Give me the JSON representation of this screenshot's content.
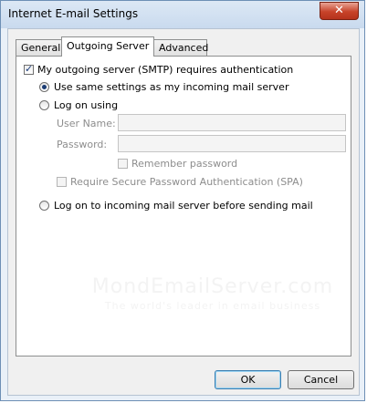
{
  "window": {
    "title": "Internet E-mail Settings",
    "close_glyph": "✕"
  },
  "tabs": [
    {
      "label": "General",
      "active": false
    },
    {
      "label": "Outgoing Server",
      "active": true
    },
    {
      "label": "Advanced",
      "active": false
    }
  ],
  "outgoing": {
    "requires_auth_label": "My outgoing server (SMTP) requires authentication",
    "requires_auth_checked": true,
    "use_same_label": "Use same settings as my incoming mail server",
    "log_on_using_label": "Log on using",
    "user_name_label": "User Name:",
    "user_name_value": "",
    "password_label": "Password:",
    "password_value": "",
    "remember_password_label": "Remember password",
    "spa_label": "Require Secure Password Authentication (SPA)",
    "log_on_incoming_label": "Log on to incoming mail server before sending mail",
    "selected_option": "use_same"
  },
  "watermark": {
    "line1": "MondEmailServer.com",
    "line2": "The world's leader in email business"
  },
  "buttons": {
    "ok_label": "OK",
    "cancel_label": "Cancel"
  }
}
